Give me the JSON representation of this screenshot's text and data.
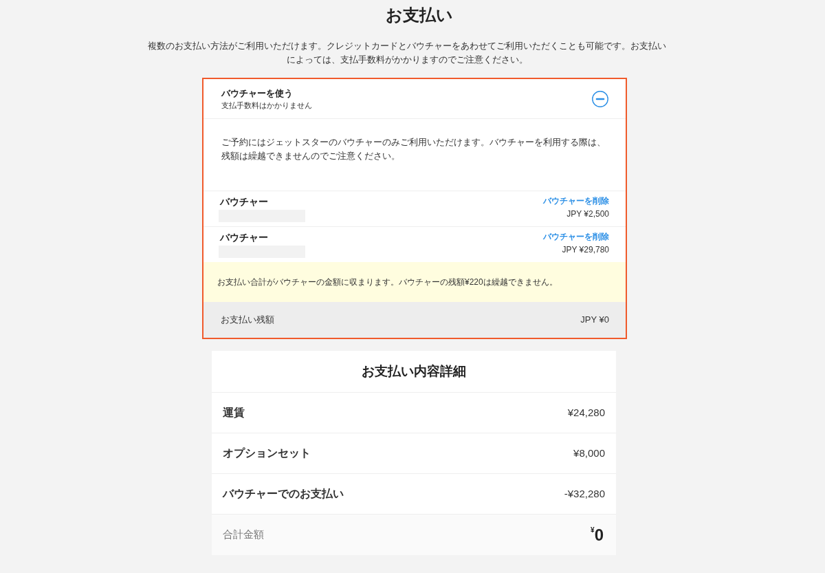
{
  "page": {
    "title": "お支払い",
    "description_lines": [
      "複数のお支払い方法がご利用いただけます。クレジットカードとバウチャーをあわせてご利用いただくことも可能です。お支払い",
      "によっては、支払手数料がかかりますのでご注意ください。"
    ]
  },
  "voucher_panel": {
    "title": "バウチャーを使う",
    "subtitle": "支払手数料はかかりません",
    "expanded": true,
    "info": "ご予約にはジェットスターのバウチャーのみご利用いただけます。バウチャーを利用する際は、残額は繰越できませんのでご注意ください。",
    "vouchers": [
      {
        "label": "バウチャー",
        "remove_link": "バウチャーを削除",
        "amount": "JPY ¥2,500"
      },
      {
        "label": "バウチャー",
        "remove_link": "バウチャーを削除",
        "amount": "JPY ¥29,780"
      }
    ],
    "notice": "お支払い合計がバウチャーの金額に収まります。バウチャーの残額¥220は繰越できません。",
    "balance": {
      "label": "お支払い残額",
      "amount": "JPY ¥0"
    }
  },
  "payment_details": {
    "title": "お支払い内容詳細",
    "rows": [
      {
        "label": "運賃",
        "amount": "¥24,280"
      },
      {
        "label": "オプションセット",
        "amount": "¥8,000"
      },
      {
        "label": "バウチャーでのお支払い",
        "amount": "-¥32,280"
      }
    ],
    "total": {
      "label": "合計金額",
      "currency": "¥",
      "amount": "0"
    }
  }
}
